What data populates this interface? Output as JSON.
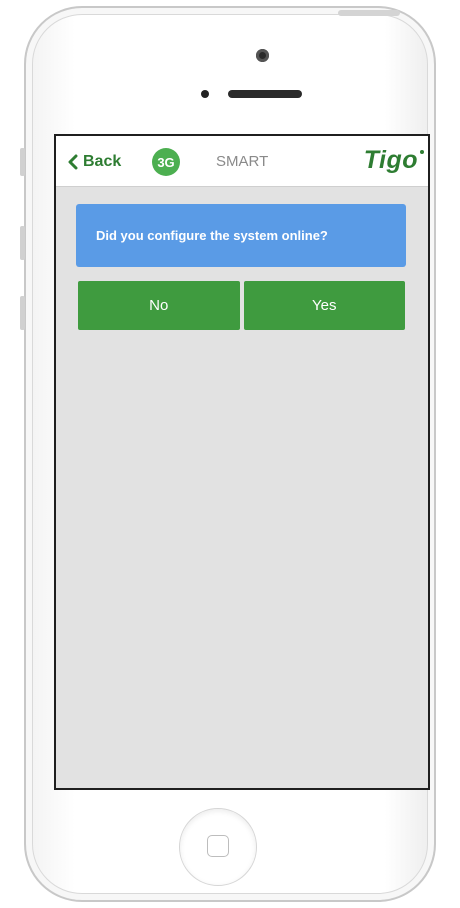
{
  "navbar": {
    "back_label": "Back",
    "network_badge": "3G",
    "title": "SMART",
    "logo_text": "Tigo",
    "accent_color": "#2e7d32"
  },
  "prompt": {
    "question": "Did you configure the system online?",
    "background_color": "#5a9be6"
  },
  "answers": {
    "no_label": "No",
    "yes_label": "Yes",
    "button_color": "#3f9b3f"
  },
  "icons": {
    "back": "chevron-left-icon",
    "camera": "camera-icon",
    "home": "home-button"
  }
}
